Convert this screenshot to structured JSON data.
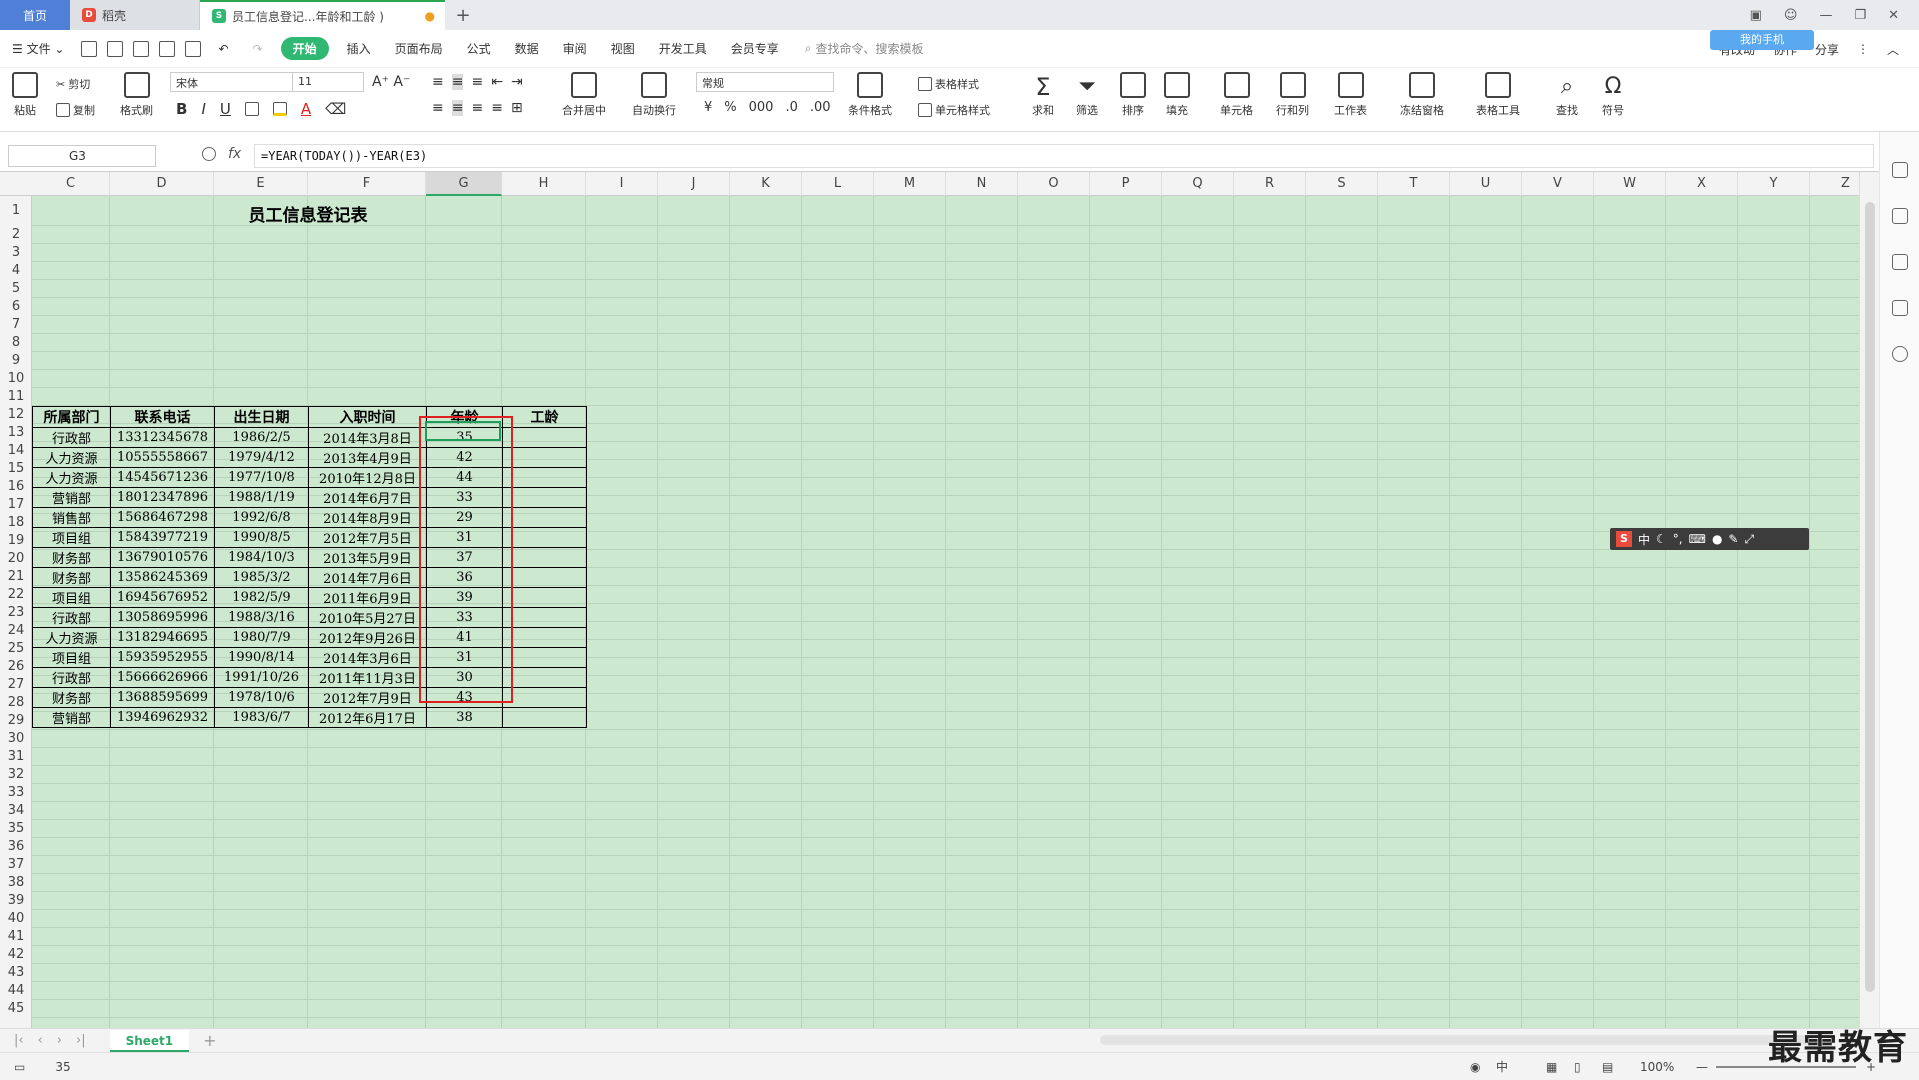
{
  "tabs": [
    {
      "label": "首页"
    },
    {
      "label": "稻壳"
    },
    {
      "label": "员工信息登记...年龄和工龄 )"
    }
  ],
  "menu": {
    "file": "文件",
    "start": "开始",
    "items": [
      "插入",
      "页面布局",
      "公式",
      "数据",
      "审阅",
      "视图",
      "开发工具",
      "会员专享"
    ],
    "search_placeholder": "查找命令、搜索模板",
    "unsynced": "有改动",
    "collab": "协作",
    "share": "分享",
    "cloud_button": "我的手机"
  },
  "ribbon": {
    "paste": "粘贴",
    "cut": "剪切",
    "copy": "复制",
    "format_painter": "格式刷",
    "font_name": "宋体",
    "font_size": "11",
    "merge_center": "合并居中",
    "wrap_text": "自动换行",
    "number_format": "常规",
    "table_style": "表格样式",
    "cond_format": "条件格式",
    "cell_style": "单元格样式",
    "sum": "求和",
    "filter": "筛选",
    "sort": "排序",
    "fill": "填充",
    "cell": "单元格",
    "row_col": "行和列",
    "worksheet": "工作表",
    "freeze": "冻结窗格",
    "table_tools": "表格工具",
    "find": "查找",
    "symbol": "符号"
  },
  "formula_bar": {
    "name_box": "G3",
    "fx": "fx",
    "formula": "=YEAR(TODAY())-YEAR(E3)"
  },
  "columns": [
    "C",
    "D",
    "E",
    "F",
    "G",
    "H",
    "I",
    "J",
    "K",
    "L",
    "M",
    "N",
    "O",
    "P",
    "Q",
    "R",
    "S",
    "T",
    "U",
    "V",
    "W",
    "X",
    "Y",
    "Z"
  ],
  "rows": [
    "1",
    "2",
    "3",
    "4",
    "5",
    "6",
    "7",
    "8",
    "9",
    "10",
    "11",
    "12",
    "13",
    "14",
    "15",
    "16",
    "17",
    "18",
    "19",
    "20",
    "21",
    "22",
    "23",
    "24",
    "25",
    "26",
    "27",
    "28",
    "29",
    "30",
    "31",
    "32",
    "33",
    "34",
    "35",
    "36",
    "37",
    "38",
    "39",
    "40",
    "41",
    "42",
    "43",
    "44",
    "45"
  ],
  "sheet_title": "员工信息登记表",
  "table_headers": [
    "所属部门",
    "联系电话",
    "出生日期",
    "入职时间",
    "年龄",
    "工龄"
  ],
  "table_rows": [
    [
      "行政部",
      "13312345678",
      "1986/2/5",
      "2014年3月8日",
      "35",
      ""
    ],
    [
      "人力资源",
      "10555558667",
      "1979/4/12",
      "2013年4月9日",
      "42",
      ""
    ],
    [
      "人力资源",
      "14545671236",
      "1977/10/8",
      "2010年12月8日",
      "44",
      ""
    ],
    [
      "营销部",
      "18012347896",
      "1988/1/19",
      "2014年6月7日",
      "33",
      ""
    ],
    [
      "销售部",
      "15686467298",
      "1992/6/8",
      "2014年8月9日",
      "29",
      ""
    ],
    [
      "项目组",
      "15843977219",
      "1990/8/5",
      "2012年7月5日",
      "31",
      ""
    ],
    [
      "财务部",
      "13679010576",
      "1984/10/3",
      "2013年5月9日",
      "37",
      ""
    ],
    [
      "财务部",
      "13586245369",
      "1985/3/2",
      "2014年7月6日",
      "36",
      ""
    ],
    [
      "项目组",
      "16945676952",
      "1982/5/9",
      "2011年6月9日",
      "39",
      ""
    ],
    [
      "行政部",
      "13058695996",
      "1988/3/16",
      "2010年5月27日",
      "33",
      ""
    ],
    [
      "人力资源",
      "13182946695",
      "1980/7/9",
      "2012年9月26日",
      "41",
      ""
    ],
    [
      "项目组",
      "15935952955",
      "1990/8/14",
      "2014年3月6日",
      "31",
      ""
    ],
    [
      "行政部",
      "15666626966",
      "1991/10/26",
      "2011年11月3日",
      "30",
      ""
    ],
    [
      "财务部",
      "13688595699",
      "1978/10/6",
      "2012年7月9日",
      "43",
      ""
    ],
    [
      "营销部",
      "13946962932",
      "1983/6/7",
      "2012年6月17日",
      "38",
      ""
    ]
  ],
  "sheet_tab": "Sheet1",
  "status": {
    "value": "35",
    "zoom": "100%"
  },
  "watermark": "最需教育",
  "colors": {
    "grid_bg": "#cce8cf",
    "accent": "#2ea869",
    "highlight": "#e02020"
  }
}
